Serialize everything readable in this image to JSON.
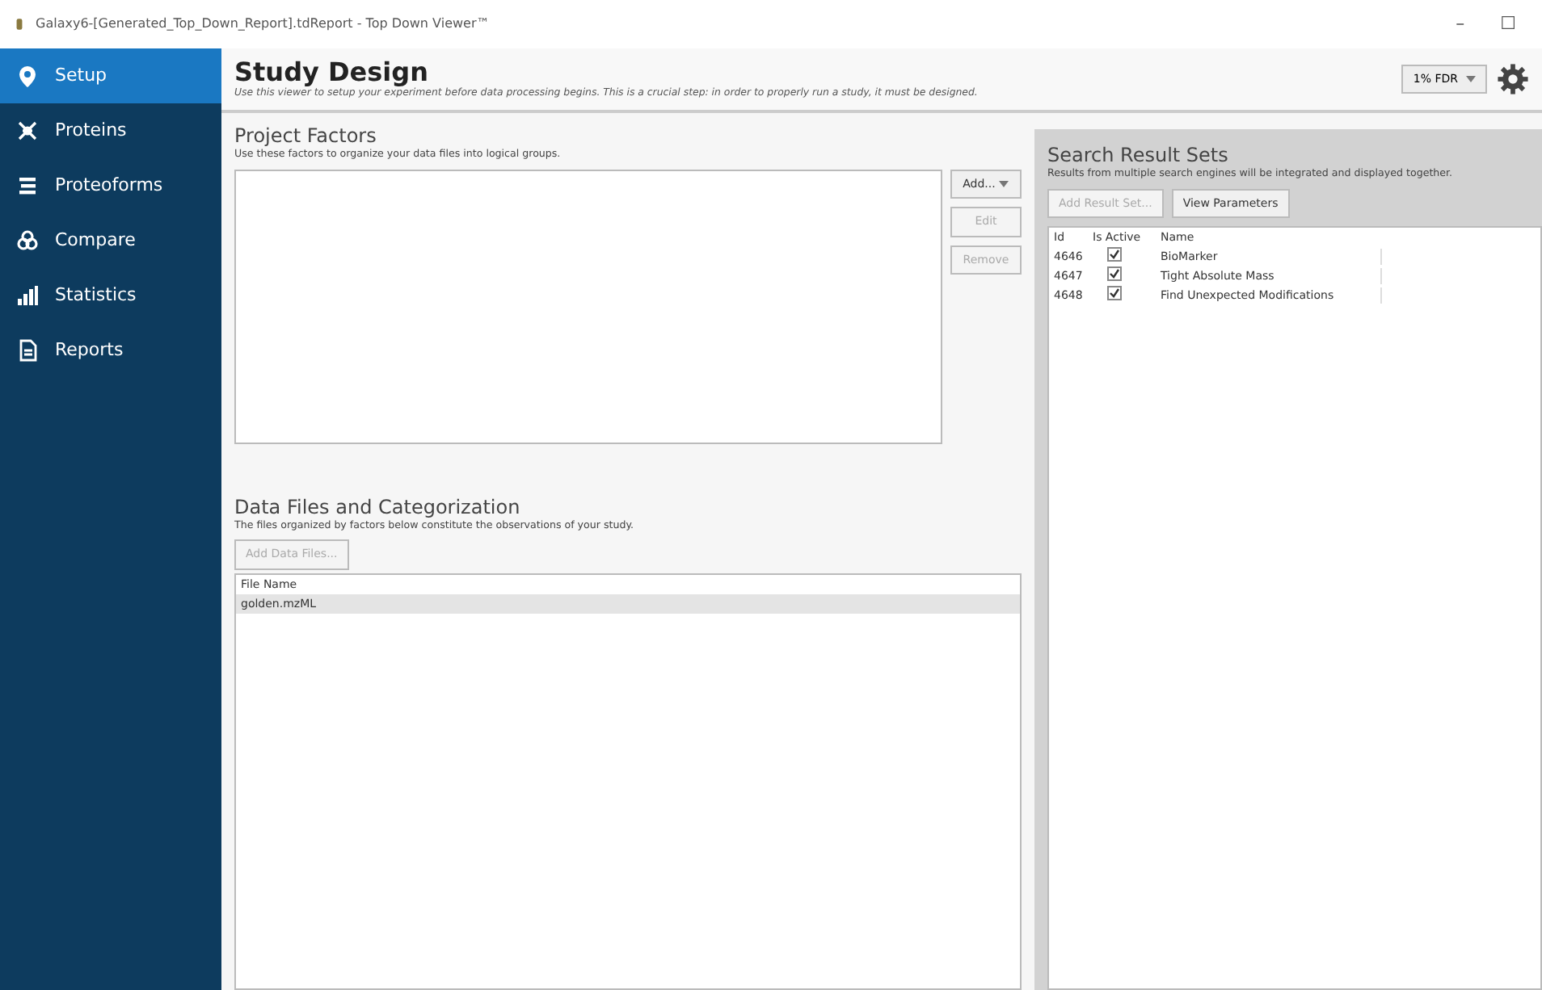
{
  "window": {
    "title": "Galaxy6-[Generated_Top_Down_Report].tdReport - Top Down Viewer™",
    "controls": [
      "–",
      "☐"
    ]
  },
  "sidebar": {
    "items": [
      {
        "label": "Setup",
        "selected": true
      },
      {
        "label": "Proteins",
        "selected": false
      },
      {
        "label": "Proteoforms",
        "selected": false
      },
      {
        "label": "Compare",
        "selected": false
      },
      {
        "label": "Statistics",
        "selected": false
      },
      {
        "label": "Reports",
        "selected": false
      }
    ]
  },
  "header": {
    "title": "Study Design",
    "subtitle": "Use this viewer to setup your experiment before data processing begins. This is a crucial step: in order to properly run a study, it must be designed.",
    "fdr": "1% FDR"
  },
  "project_factors": {
    "title": "Project Factors",
    "description": "Use these factors to organize your data files into logical groups.",
    "buttons": [
      {
        "label": "Add...",
        "disabled": false,
        "dropdown": true
      },
      {
        "label": "Edit",
        "disabled": true,
        "dropdown": false
      },
      {
        "label": "Remove",
        "disabled": true,
        "dropdown": false
      }
    ]
  },
  "data_files": {
    "title": "Data Files and Categorization",
    "description": "The files organized by factors below constitute the observations of your study.",
    "add_button": {
      "label": "Add Data Files...",
      "disabled": true
    },
    "columns": [
      "File Name"
    ],
    "rows": [
      {
        "file_name": "golden.mzML",
        "selected": true
      }
    ]
  },
  "search_result_sets": {
    "title": "Search Result Sets",
    "description": "Results from multiple search engines will be integrated and displayed together.",
    "buttons": [
      {
        "label": "Add Result Set...",
        "disabled": true
      },
      {
        "label": "View Parameters",
        "disabled": false
      }
    ],
    "columns": [
      "Id",
      "Is Active",
      "Name"
    ],
    "rows": [
      {
        "id": "4646",
        "active": true,
        "name": "BioMarker"
      },
      {
        "id": "4647",
        "active": true,
        "name": "Tight Absolute Mass"
      },
      {
        "id": "4648",
        "active": true,
        "name": "Find Unexpected Modifications"
      }
    ]
  }
}
